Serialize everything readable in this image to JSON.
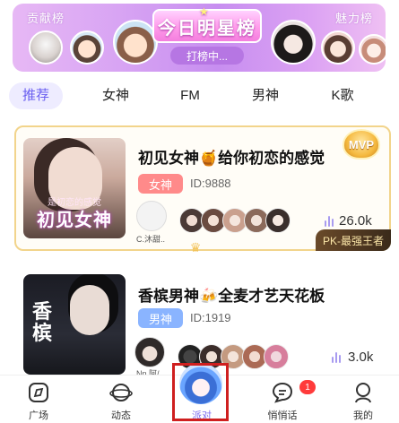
{
  "banner": {
    "left_label": "贡献榜",
    "right_label": "魅力榜",
    "title": "今日明星榜",
    "subtitle": "打榜中..."
  },
  "tabs": [
    {
      "label": "推荐",
      "active": true
    },
    {
      "label": "女神",
      "active": false
    },
    {
      "label": "FM",
      "active": false
    },
    {
      "label": "男神",
      "active": false
    },
    {
      "label": "K歌",
      "active": false
    }
  ],
  "rooms": [
    {
      "title": "初见女神🍯给你初恋的感觉",
      "tag": "女神",
      "tag_color": "#ff8a8a",
      "id_text": "ID:9888",
      "host_name": "C.沐甜..",
      "listeners": "26.0k",
      "thumb_text": "初见女神",
      "thumb_subtext": "是初恋的感觉",
      "badge": "MVP",
      "ribbon": "PK-最强王者"
    },
    {
      "title": "香槟男神🍻全麦才艺天花板",
      "tag": "男神",
      "tag_color": "#8ab4ff",
      "id_text": "ID:1919",
      "host_name": "Nn.阿/..",
      "listeners": "3.0k",
      "thumb_text": "香\n槟"
    }
  ],
  "nav": [
    {
      "label": "广场",
      "icon": "square-icon"
    },
    {
      "label": "动态",
      "icon": "planet-icon"
    },
    {
      "label": "派对",
      "icon": "party-avatar-icon"
    },
    {
      "label": "悄悄话",
      "icon": "chat-icon",
      "badge": "1"
    },
    {
      "label": "我的",
      "icon": "profile-icon"
    }
  ],
  "colors": {
    "accent": "#7a6af0",
    "highlight": "#cf1f1f"
  }
}
